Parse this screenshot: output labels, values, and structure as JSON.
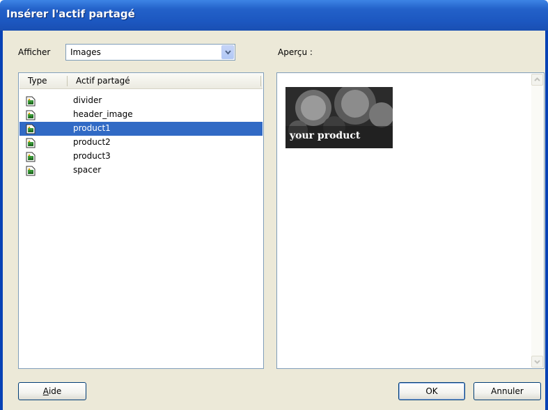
{
  "window": {
    "title": "Insérer l'actif partagé"
  },
  "filter": {
    "label": "Afficher",
    "selected": "Images"
  },
  "list": {
    "headers": {
      "type": "Type",
      "asset": "Actif partagé"
    },
    "items": [
      {
        "name": "divider",
        "icon": "image-file-icon",
        "selected": false
      },
      {
        "name": "header_image",
        "icon": "image-file-icon",
        "selected": false
      },
      {
        "name": "product1",
        "icon": "image-file-icon",
        "selected": true
      },
      {
        "name": "product2",
        "icon": "image-file-icon",
        "selected": false
      },
      {
        "name": "product3",
        "icon": "image-file-icon",
        "selected": false
      },
      {
        "name": "spacer",
        "icon": "image-file-icon",
        "selected": false
      }
    ]
  },
  "preview": {
    "label": "Aperçu :",
    "image_text": "your product"
  },
  "buttons": {
    "help": "Aide",
    "ok": "OK",
    "cancel": "Annuler"
  },
  "colors": {
    "titlebar": "#2361c9",
    "selection": "#316ac5",
    "dialog_bg": "#ece9d8"
  }
}
